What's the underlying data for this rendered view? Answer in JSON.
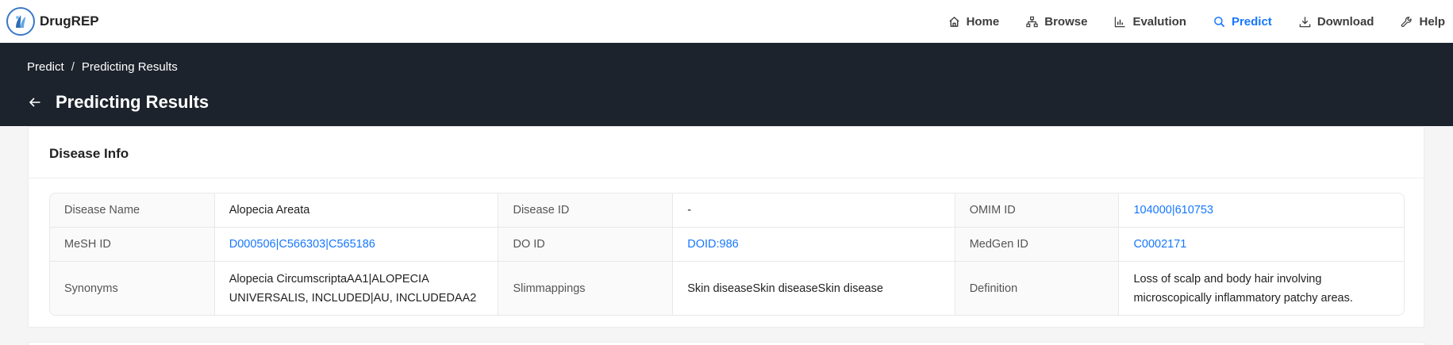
{
  "brand": {
    "name": "DrugREP"
  },
  "nav": {
    "items": [
      {
        "label": "Home",
        "icon": "home-icon"
      },
      {
        "label": "Browse",
        "icon": "sitemap-icon"
      },
      {
        "label": "Evalution",
        "icon": "bar-chart-icon"
      },
      {
        "label": "Predict",
        "icon": "search-icon",
        "active": true
      },
      {
        "label": "Download",
        "icon": "download-icon"
      },
      {
        "label": "Help",
        "icon": "wrench-icon"
      }
    ]
  },
  "breadcrumb": {
    "items": [
      "Predict",
      "Predicting Results"
    ],
    "separator": "/"
  },
  "page": {
    "title": "Predicting Results"
  },
  "disease_info": {
    "title": "Disease Info",
    "rows": [
      {
        "c1_label": "Disease Name",
        "c1_value": "Alopecia Areata",
        "c2_label": "Disease ID",
        "c2_value": "-",
        "c3_label": "OMIM ID",
        "c3_value": "104000|610753"
      },
      {
        "c1_label": "MeSH ID",
        "c1_value": "D000506|C566303|C565186",
        "c2_label": "DO ID",
        "c2_value": "DOID:986",
        "c3_label": "MedGen ID",
        "c3_value": "C0002171"
      },
      {
        "c1_label": "Synonyms",
        "c1_value_line1": "Alopecia CircumscriptaAA1|ALOPECIA",
        "c1_value_line2": "UNIVERSALIS, INCLUDED|AU, INCLUDEDAA2",
        "c2_label": "Slimmappings",
        "c2_value": "Skin diseaseSkin diseaseSkin disease",
        "c3_label": "Definition",
        "c3_value_line1": "Loss of scalp and body hair involving",
        "c3_value_line2": "microscopically inflammatory patchy areas."
      }
    ]
  },
  "colors": {
    "accent": "#1677ff",
    "header_bg": "#1d232c",
    "link": "#1677ff"
  }
}
